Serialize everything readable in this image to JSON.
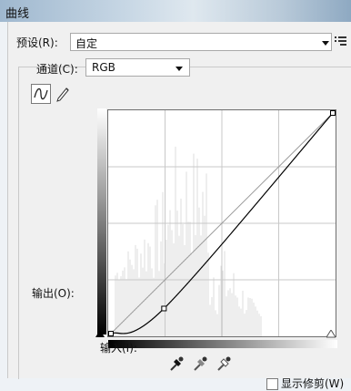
{
  "window": {
    "title": "曲线"
  },
  "preset": {
    "label": "预设(R):",
    "value": "自定"
  },
  "channel": {
    "label": "通道(C):",
    "value": "RGB"
  },
  "graph": {
    "output_label": "输出(O):",
    "input_label": "输入(I):"
  },
  "curve_points": [
    {
      "input": 0,
      "output": 0
    },
    {
      "input": 61,
      "output": 29
    },
    {
      "input": 255,
      "output": 255
    }
  ],
  "options": {
    "show_clipping_label": "显示修剪(W)",
    "show_clipping_checked": false
  },
  "icons": {
    "preset_menu": "list-options-icon",
    "curve_tool": "curve-tool-icon",
    "pencil_tool": "pencil-icon",
    "eyedroppers": [
      "black-eyedropper-icon",
      "gray-eyedropper-icon",
      "white-eyedropper-icon"
    ]
  }
}
